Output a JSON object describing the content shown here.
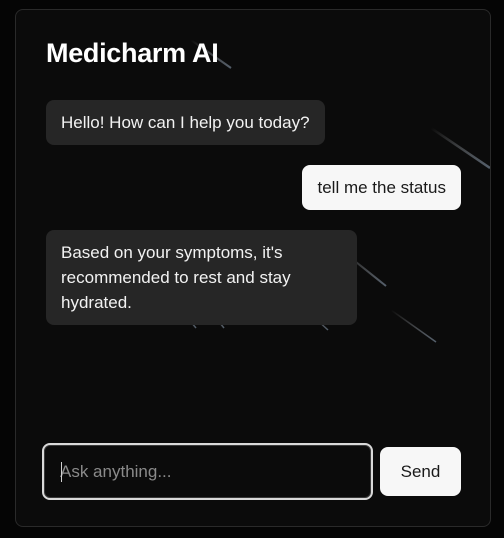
{
  "app": {
    "title": "Medicharm AI"
  },
  "messages": [
    {
      "role": "assistant",
      "text": "Hello! How can I help you today?"
    },
    {
      "role": "user",
      "text": "tell me the status"
    },
    {
      "role": "assistant",
      "text": "Based on your symptoms, it's recommended to rest and stay hydrated."
    }
  ],
  "composer": {
    "placeholder": "Ask anything...",
    "value": "",
    "send_label": "Send"
  },
  "colors": {
    "background": "#0b0b0b",
    "bot_bubble": "#262626",
    "user_bubble": "#f7f7f7",
    "button": "#f7f7f7"
  }
}
